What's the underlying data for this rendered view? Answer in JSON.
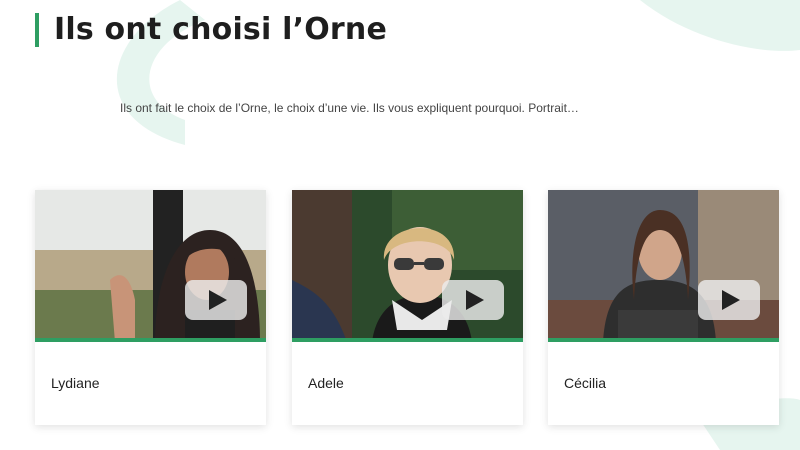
{
  "page": {
    "title": "Ils ont choisi l’Orne",
    "intro": "Ils ont fait le choix de l’Orne, le choix d’une vie. Ils vous expliquent pourquoi. Portrait…"
  },
  "colors": {
    "accent": "#2e9e62",
    "decor": "#e4f4ee"
  },
  "cards": [
    {
      "name": "Lydiane",
      "play_icon": "play-icon"
    },
    {
      "name": "Adele",
      "play_icon": "play-icon"
    },
    {
      "name": "Cécilia",
      "play_icon": "play-icon"
    }
  ]
}
